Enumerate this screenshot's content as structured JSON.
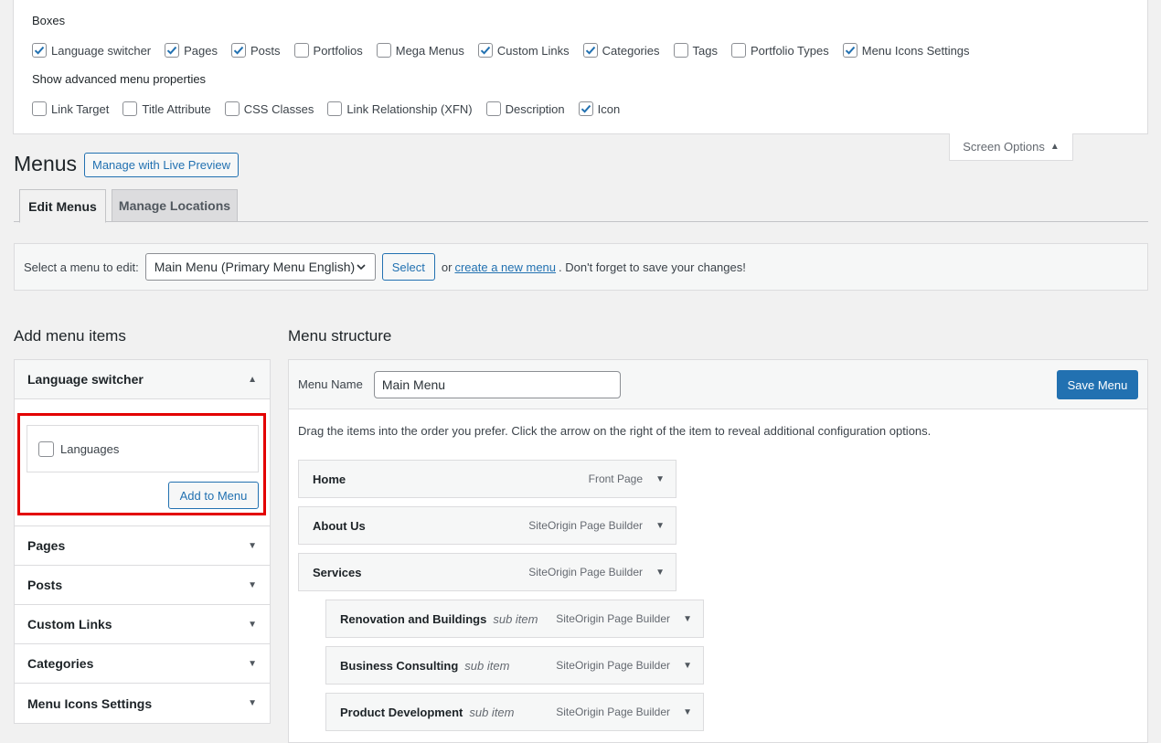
{
  "screen_options": {
    "boxes_heading": "Boxes",
    "boxes": [
      {
        "label": "Language switcher",
        "checked": true
      },
      {
        "label": "Pages",
        "checked": true
      },
      {
        "label": "Posts",
        "checked": true
      },
      {
        "label": "Portfolios",
        "checked": false
      },
      {
        "label": "Mega Menus",
        "checked": false
      },
      {
        "label": "Custom Links",
        "checked": true
      },
      {
        "label": "Categories",
        "checked": true
      },
      {
        "label": "Tags",
        "checked": false
      },
      {
        "label": "Portfolio Types",
        "checked": false
      },
      {
        "label": "Menu Icons Settings",
        "checked": true
      }
    ],
    "advanced_heading": "Show advanced menu properties",
    "advanced": [
      {
        "label": "Link Target",
        "checked": false
      },
      {
        "label": "Title Attribute",
        "checked": false
      },
      {
        "label": "CSS Classes",
        "checked": false
      },
      {
        "label": "Link Relationship (XFN)",
        "checked": false
      },
      {
        "label": "Description",
        "checked": false
      },
      {
        "label": "Icon",
        "checked": true
      }
    ],
    "toggle_label": "Screen Options"
  },
  "header": {
    "title": "Menus",
    "live_preview_label": "Manage with Live Preview"
  },
  "tabs": {
    "edit": "Edit Menus",
    "manage": "Manage Locations"
  },
  "select_menu": {
    "label": "Select a menu to edit:",
    "selected": "Main Menu (Primary Menu English)",
    "button": "Select",
    "or_text": "or",
    "create_link": "create a new menu",
    "reminder": ". Don't forget to save your changes!"
  },
  "add_items": {
    "heading": "Add menu items",
    "open_panel": "Language switcher",
    "language_option": "Languages",
    "add_button": "Add to Menu",
    "panels": [
      "Pages",
      "Posts",
      "Custom Links",
      "Categories",
      "Menu Icons Settings"
    ]
  },
  "structure": {
    "heading": "Menu structure",
    "name_label": "Menu Name",
    "name_value": "Main Menu",
    "save_label": "Save Menu",
    "instructions": "Drag the items into the order you prefer. Click the arrow on the right of the item to reveal additional configuration options.",
    "items": [
      {
        "title": "Home",
        "sub": "",
        "type": "Front Page",
        "depth": 0
      },
      {
        "title": "About Us",
        "sub": "",
        "type": "SiteOrigin Page Builder",
        "depth": 0
      },
      {
        "title": "Services",
        "sub": "",
        "type": "SiteOrigin Page Builder",
        "depth": 0
      },
      {
        "title": "Renovation and Buildings",
        "sub": "sub item",
        "type": "SiteOrigin Page Builder",
        "depth": 1
      },
      {
        "title": "Business Consulting",
        "sub": "sub item",
        "type": "SiteOrigin Page Builder",
        "depth": 1
      },
      {
        "title": "Product Development",
        "sub": "sub item",
        "type": "SiteOrigin Page Builder",
        "depth": 1
      }
    ]
  },
  "colors": {
    "accent": "#2271b1",
    "highlight": "#e30000"
  }
}
